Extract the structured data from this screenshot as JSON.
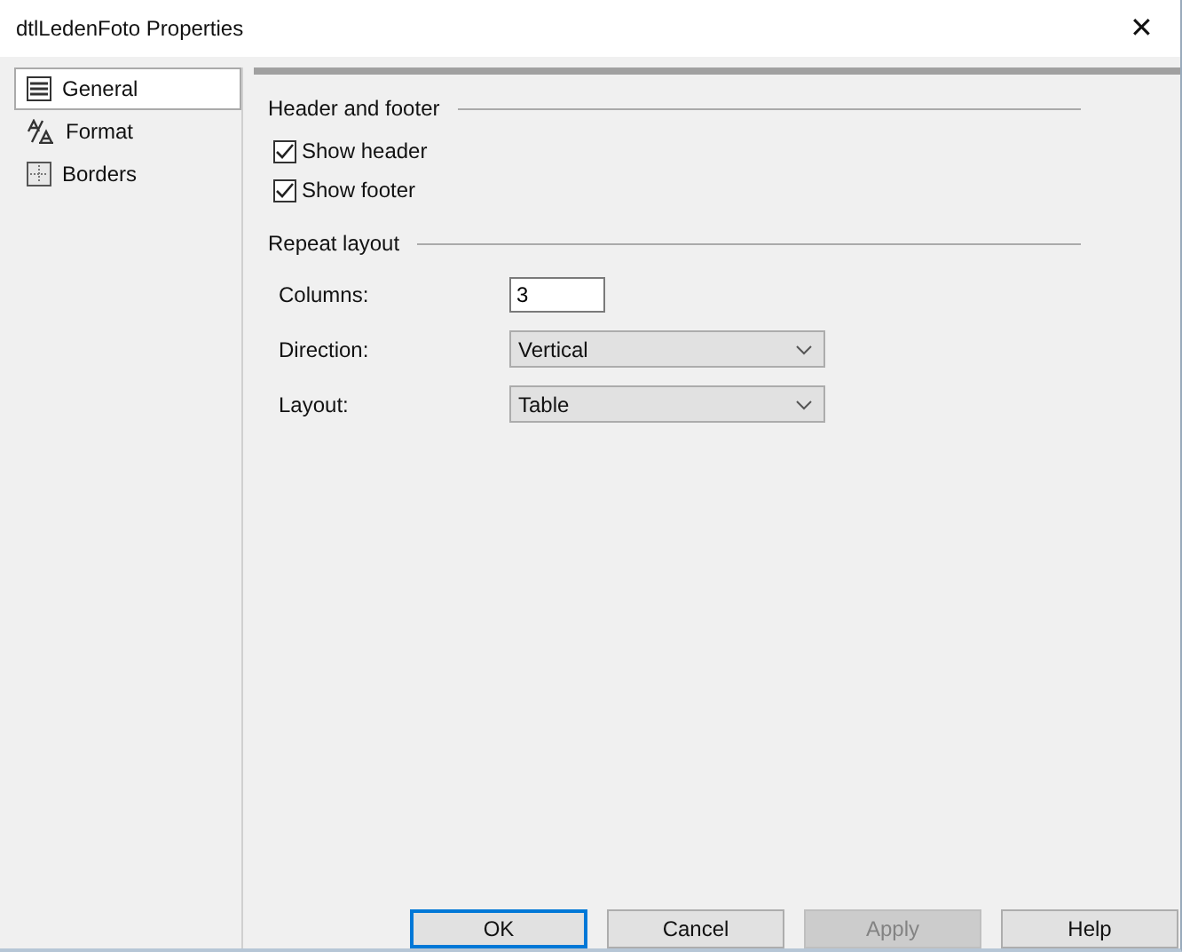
{
  "window": {
    "title": "dtlLedenFoto Properties",
    "close": "✕"
  },
  "sidebar": {
    "items": [
      {
        "label": "General",
        "selected": true
      },
      {
        "label": "Format",
        "selected": false
      },
      {
        "label": "Borders",
        "selected": false
      }
    ]
  },
  "header_footer": {
    "title": "Header and footer",
    "checkboxes": [
      {
        "label": "Show header",
        "checked": true
      },
      {
        "label": "Show footer",
        "checked": true
      }
    ]
  },
  "repeat_layout": {
    "title": "Repeat layout",
    "fields": [
      {
        "kind": "text",
        "label": "Columns:",
        "value": "3"
      },
      {
        "kind": "dropdown",
        "label": "Direction:",
        "value": "Vertical"
      },
      {
        "kind": "dropdown",
        "label": "Layout:",
        "value": "Table"
      }
    ]
  },
  "buttons": [
    {
      "label": "OK",
      "default": true,
      "disabled": false
    },
    {
      "label": "Cancel",
      "default": false,
      "disabled": false
    },
    {
      "label": "Apply",
      "default": false,
      "disabled": true
    },
    {
      "label": "Help",
      "default": false,
      "disabled": false
    }
  ]
}
